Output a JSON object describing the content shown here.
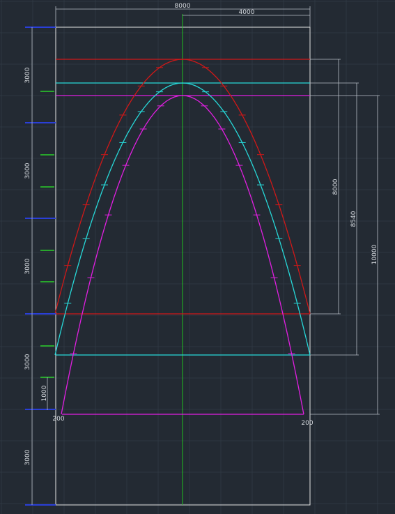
{
  "dimensions": {
    "top_width": "8000",
    "top_half": "4000",
    "left_segments": [
      "3000",
      "3000",
      "3000",
      "3000",
      "3000"
    ],
    "left_small": "1000",
    "right_heights": [
      "8000",
      "8540",
      "10000"
    ],
    "base_offsets": [
      "200",
      "200"
    ]
  },
  "colors": {
    "background": "#232a33",
    "grid": "#2e3742",
    "frame": "#e6e6e6",
    "axis": "#1fbf1f",
    "red_curve": "#d01818",
    "cyan_curve": "#27d9d9",
    "magenta_curve": "#e21fe2",
    "blue_marks": "#2a3fd8",
    "green_marks": "#2bd02b",
    "dim_line": "#b8bec6"
  }
}
